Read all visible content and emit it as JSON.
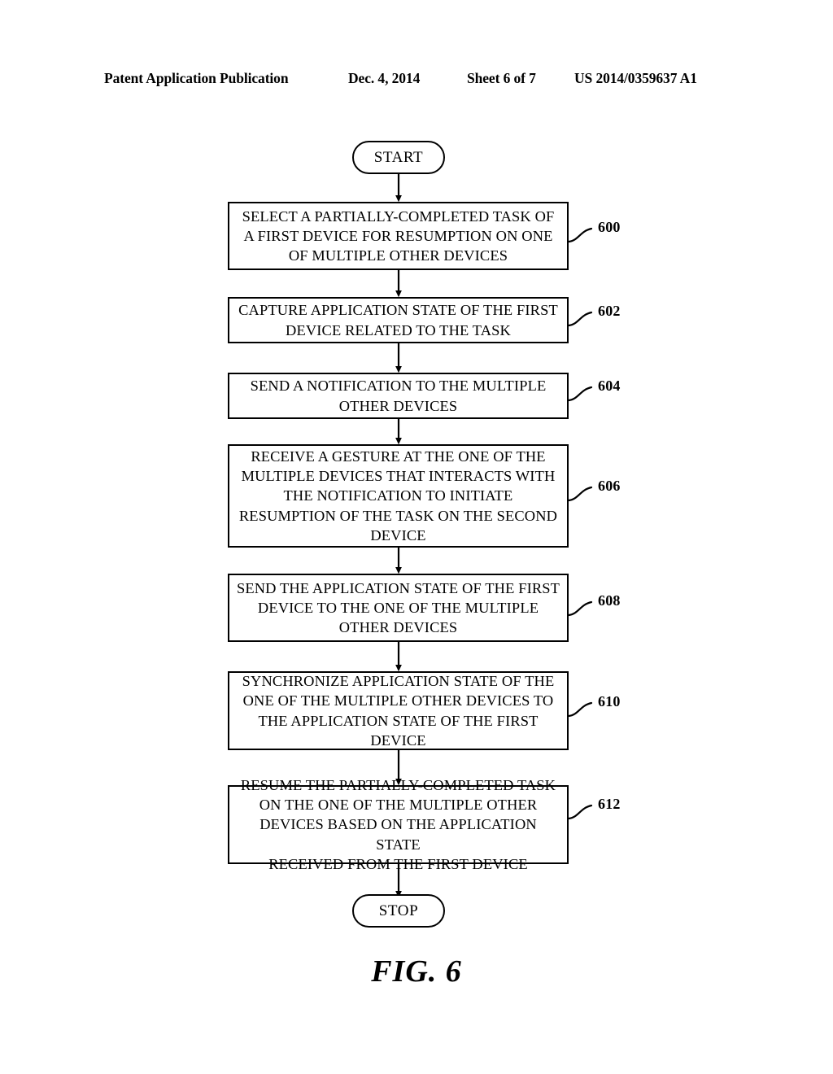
{
  "header": {
    "publication": "Patent Application Publication",
    "date": "Dec. 4, 2014",
    "sheet": "Sheet 6 of 7",
    "patent_number": "US 2014/0359637 A1"
  },
  "caption": "FIG. 6",
  "flowchart": {
    "start_label": "START",
    "stop_label": "STOP",
    "steps": [
      {
        "ref": "600",
        "text": "SELECT A PARTIALLY-COMPLETED TASK OF\nA FIRST DEVICE FOR RESUMPTION ON ONE\nOF MULTIPLE OTHER DEVICES"
      },
      {
        "ref": "602",
        "text": "CAPTURE APPLICATION STATE OF THE FIRST\nDEVICE RELATED TO THE TASK"
      },
      {
        "ref": "604",
        "text": "SEND A NOTIFICATION TO THE MULTIPLE\nOTHER DEVICES"
      },
      {
        "ref": "606",
        "text": "RECEIVE A GESTURE AT THE ONE OF THE\nMULTIPLE DEVICES THAT INTERACTS WITH\nTHE NOTIFICATION TO INITIATE\nRESUMPTION OF THE TASK ON THE SECOND\nDEVICE"
      },
      {
        "ref": "608",
        "text": "SEND THE APPLICATION STATE OF THE FIRST\nDEVICE TO THE ONE OF THE MULTIPLE\nOTHER DEVICES"
      },
      {
        "ref": "610",
        "text": "SYNCHRONIZE APPLICATION STATE OF THE\nONE OF THE MULTIPLE OTHER DEVICES TO\nTHE APPLICATION STATE OF THE FIRST\nDEVICE"
      },
      {
        "ref": "612",
        "text": "RESUME THE PARTIALLY-COMPLETED TASK\nON THE ONE OF THE MULTIPLE OTHER\nDEVICES BASED ON THE APPLICATION STATE\nRECEIVED FROM THE FIRST DEVICE"
      }
    ]
  }
}
